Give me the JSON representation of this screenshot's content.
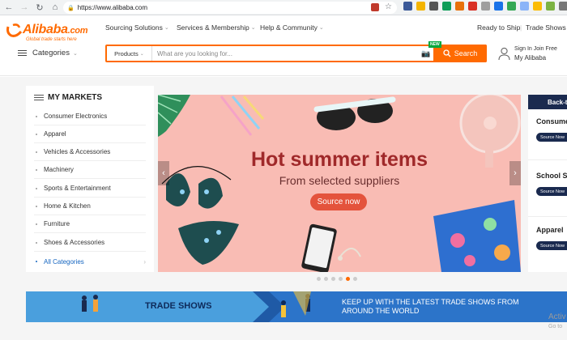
{
  "browser": {
    "url": "https://www.alibaba.com",
    "back_icon": "back-arrow",
    "forward_icon": "forward-arrow",
    "reload_icon": "reload",
    "home_icon": "home"
  },
  "header": {
    "logo_text": "Alibaba",
    "logo_com": ".com",
    "logo_tagline": "Global trade starts here",
    "nav": [
      {
        "label": "Sourcing Solutions"
      },
      {
        "label": "Services & Membership"
      },
      {
        "label": "Help & Community"
      }
    ],
    "right_links": [
      "Ready to Ship",
      "Trade Shows"
    ],
    "categories_label": "Categories",
    "search": {
      "category": "Products",
      "placeholder": "What are you looking for...",
      "button": "Search",
      "badge": "NEW"
    },
    "signin": {
      "line1": "Sign In  Join Free",
      "line2": "My Alibaba"
    }
  },
  "markets": {
    "title": "MY MARKETS",
    "items": [
      "Consumer Electronics",
      "Apparel",
      "Vehicles & Accessories",
      "Machinery",
      "Sports & Entertainment",
      "Home & Kitchen",
      "Furniture",
      "Shoes & Accessories"
    ],
    "all_label": "All Categories"
  },
  "banner": {
    "title": "Hot summer items",
    "subtitle": "From selected suppliers",
    "cta": "Source now",
    "slides": 6,
    "active_slide": 5
  },
  "right_panel": {
    "header": "Back-to",
    "items": [
      {
        "label": "Consume",
        "button": "Source Now"
      },
      {
        "label": "School S",
        "button": "Source Now"
      },
      {
        "label": "Apparel",
        "button": "Source Now"
      }
    ]
  },
  "trade": {
    "title": "TRADE SHOWS",
    "text": "KEEP UP WITH THE LATEST TRADE SHOWS FROM AROUND THE WORLD"
  },
  "watermark": {
    "line1": "Activ",
    "line2": "Go to"
  },
  "colors": {
    "brand": "#ff6a00",
    "navy": "#1a2a4f",
    "banner_bg": "#f9bcb4",
    "trade_blue": "#2c74c9"
  }
}
